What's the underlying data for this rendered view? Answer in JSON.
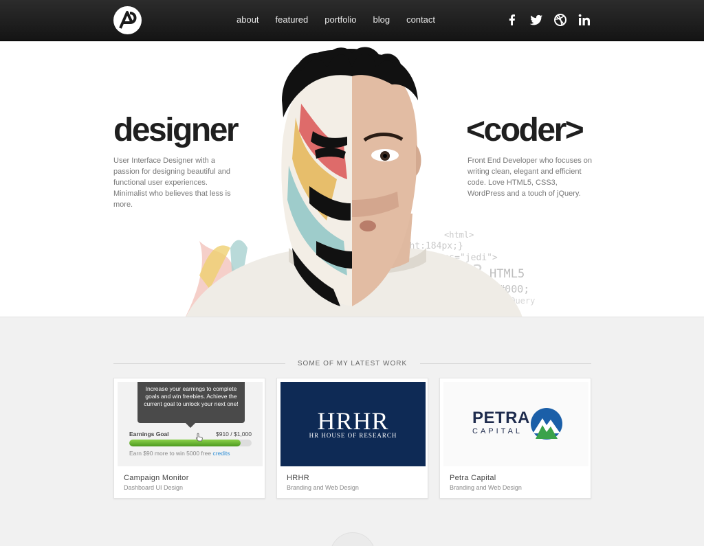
{
  "nav": {
    "items": [
      {
        "label": "about"
      },
      {
        "label": "featured"
      },
      {
        "label": "portfolio"
      },
      {
        "label": "blog"
      },
      {
        "label": "contact"
      }
    ]
  },
  "social": [
    "facebook-icon",
    "twitter-icon",
    "dribbble-icon",
    "linkedin-icon"
  ],
  "hero": {
    "left_title": "designer",
    "left_text": "User Interface Designer with a passion for designing beautiful and functional user experiences. Minimalist who believes that less is more.",
    "right_title": "<coder>",
    "right_text": "Front End Developer who focuses on writing clean, elegant and efficient code. Love HTML5, CSS3, WordPress and a touch of jQuery.",
    "code_words": [
      "<html>",
      "eight:184px;}",
      "class=\"jedi\">",
      "CSS3",
      "HTML5",
      "olor:#000;",
      "jQuery"
    ]
  },
  "work": {
    "heading": "SOME OF MY LATEST WORK",
    "cards": [
      {
        "name": "Campaign Monitor",
        "sub": "Dashboard UI Design",
        "tooltip": "Increase your earnings to complete goals and win freebies. Achieve the current goal to unlock your next one!",
        "goal_label": "Earnings Goal",
        "goal_amount": "$910 / $1,000",
        "progress": 0.91,
        "earn_text": "Earn $90 more to win 5000 free ",
        "earn_link": "credits"
      },
      {
        "name": "HRHR",
        "sub": "Branding and Web Design",
        "logo_big": "HRHR",
        "logo_small": "HR HOUSE OF RESEARCH"
      },
      {
        "name": "Petra Capital",
        "sub": "Branding and Web Design",
        "logo_big": "PETRA",
        "logo_small": "CAPITAL"
      }
    ]
  },
  "colors": {
    "header": "#1a1a1a",
    "hr_navy": "#0e2a55",
    "progress_green": "#6cb833",
    "petra_blue": "#1b5fa8",
    "petra_green": "#3aa24a"
  }
}
